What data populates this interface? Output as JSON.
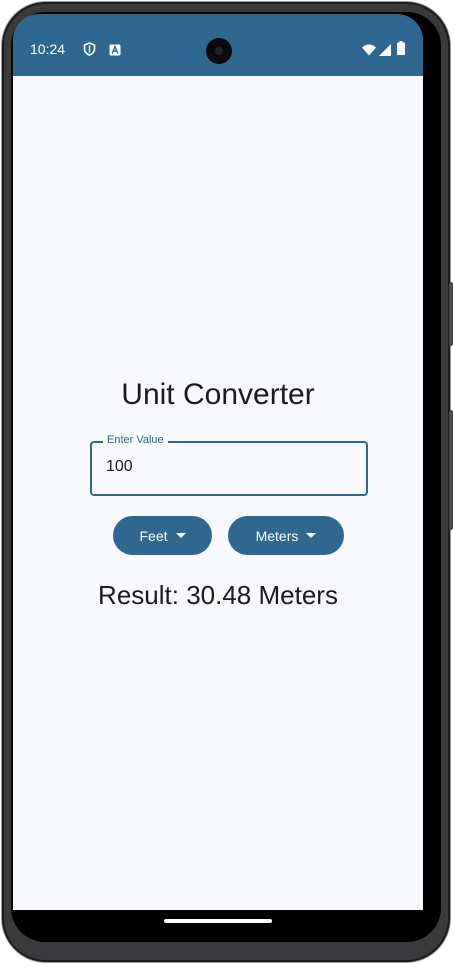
{
  "status_bar": {
    "time": "10:24",
    "left_icons": [
      "shield-icon",
      "a-badge-icon"
    ],
    "right_icons": [
      "wifi-icon",
      "signal-icon",
      "battery-icon"
    ],
    "color": "#2e6890"
  },
  "app": {
    "title": "Unit Converter",
    "input": {
      "label": "Enter Value",
      "value": "100"
    },
    "from_unit": {
      "label": "Feet"
    },
    "to_unit": {
      "label": "Meters"
    },
    "result": "Result: 30.48 Meters"
  },
  "colors": {
    "accent": "#2e6890",
    "background": "#f8f9fd",
    "text": "#1b1b1f"
  }
}
